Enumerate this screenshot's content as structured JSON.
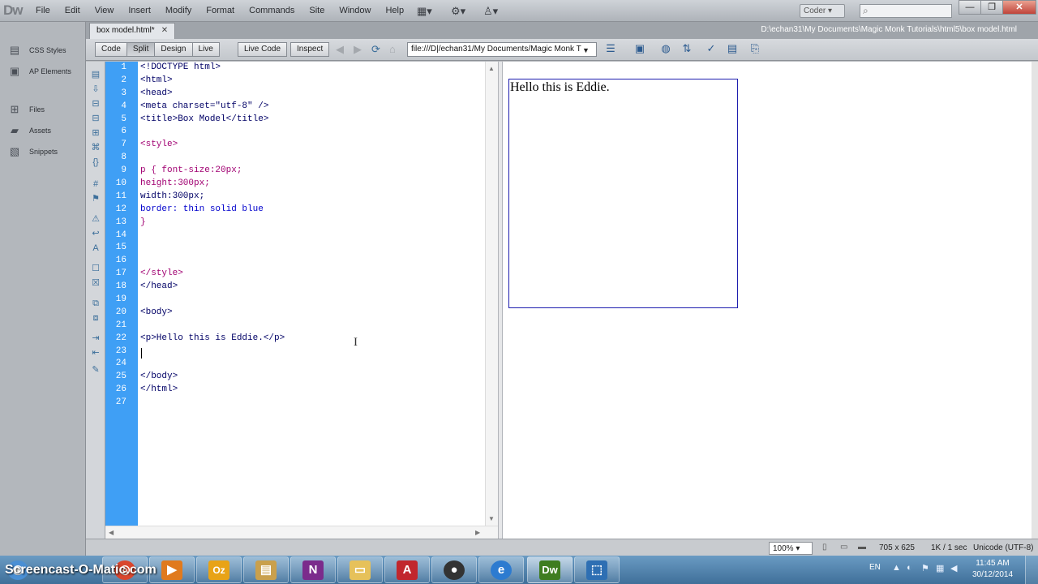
{
  "app": {
    "logo": "Dw"
  },
  "menu": [
    "File",
    "Edit",
    "View",
    "Insert",
    "Modify",
    "Format",
    "Commands",
    "Site",
    "Window",
    "Help"
  ],
  "workspace": {
    "label": "Coder"
  },
  "window_controls": {
    "minimize": "—",
    "restore": "❐",
    "close": "✕"
  },
  "panels": [
    {
      "label": "CSS Styles",
      "icon": "css-styles-icon"
    },
    {
      "label": "AP Elements",
      "icon": "ap-elements-icon"
    },
    {
      "label": "Files",
      "icon": "files-icon"
    },
    {
      "label": "Assets",
      "icon": "assets-icon"
    },
    {
      "label": "Snippets",
      "icon": "snippets-icon"
    }
  ],
  "document": {
    "tab_label": "box model.html*",
    "path": "D:\\echan31\\My Documents\\Magic Monk Tutorials\\html5\\box model.html"
  },
  "toolbar": {
    "views": [
      "Code",
      "Split",
      "Design",
      "Live"
    ],
    "active_view": "Split",
    "tools": [
      "Live Code",
      "Inspect"
    ],
    "address": "file:///D|/echan31/My Documents/Magic Monk T"
  },
  "code_lines": [
    "<!DOCTYPE html>",
    "<html>",
    "<head>",
    "<meta charset=\"utf-8\" />",
    "<title>Box Model</title>",
    "",
    "<style>",
    "",
    "p { font-size:20px;",
    "height:300px;",
    "width:300px;",
    "border: thin solid blue",
    "}",
    "",
    "",
    "",
    "</style>",
    "</head>",
    "",
    "<body>",
    "",
    "<p>Hello this is Eddie.</p>",
    "",
    "",
    "</body>",
    "</html>",
    ""
  ],
  "line_numbers": [
    "1",
    "2",
    "3",
    "4",
    "5",
    "6",
    "7",
    "8",
    "9",
    "10",
    "11",
    "12",
    "13",
    "14",
    "15",
    "16",
    "17",
    "18",
    "19",
    "20",
    "21",
    "22",
    "23",
    "24",
    "25",
    "26",
    "27"
  ],
  "design": {
    "paragraph_text": "Hello this is Eddie."
  },
  "status": {
    "zoom": "100%",
    "dimensions": "705 x 625",
    "download": "1K / 1 sec",
    "encoding": "Unicode (UTF-8)"
  },
  "taskbar": {
    "watermark": "Screencast-O-Matic.com",
    "language": "EN",
    "time": "11:45 AM",
    "date": "30/12/2014",
    "apps": [
      {
        "name": "start-orb-icon",
        "glyph": "◉",
        "color": "#4a8fd4"
      },
      {
        "name": "chrome-icon",
        "glyph": "◎",
        "color": "#d9462e"
      },
      {
        "name": "media-player-icon",
        "glyph": "▶",
        "color": "#e07a1e"
      },
      {
        "name": "outlook-icon",
        "glyph": "Oz",
        "color": "#e8a317"
      },
      {
        "name": "files-archive-icon",
        "glyph": "▤",
        "color": "#c9a04d"
      },
      {
        "name": "onenote-icon",
        "glyph": "N",
        "color": "#7b2b8c"
      },
      {
        "name": "folder-icon",
        "glyph": "▭",
        "color": "#e6c15a"
      },
      {
        "name": "acrobat-icon",
        "glyph": "A",
        "color": "#c1272d"
      },
      {
        "name": "screencast-icon",
        "glyph": "●",
        "color": "#333333"
      },
      {
        "name": "internet-explorer-icon",
        "glyph": "e",
        "color": "#2d7bd0"
      },
      {
        "name": "dreamweaver-icon",
        "glyph": "Dw",
        "color": "#3f7d20"
      },
      {
        "name": "snipping-tool-icon",
        "glyph": "⬚",
        "color": "#2e6fb3"
      }
    ]
  }
}
